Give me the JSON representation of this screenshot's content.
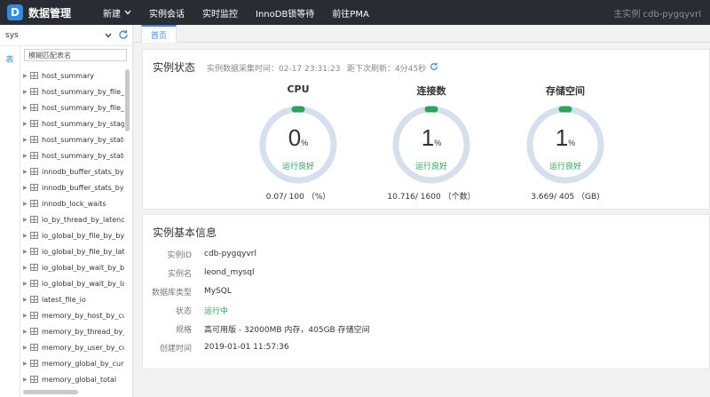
{
  "app": {
    "logo": "D",
    "title": "数据管理"
  },
  "nav": [
    {
      "label": "新建",
      "has_dropdown": true
    },
    {
      "label": "实例会话"
    },
    {
      "label": "实时监控"
    },
    {
      "label": "InnoDB锁等待"
    },
    {
      "label": "前往PMA"
    }
  ],
  "instance_label": "主实例 cdb-pygqyvrl",
  "sidebar": {
    "db_selected": "sys",
    "side_tab": "表",
    "filter_placeholder": "模糊匹配表名",
    "tables": [
      "host_summary",
      "host_summary_by_file_io",
      "host_summary_by_file_io_type",
      "host_summary_by_stages",
      "host_summary_by_statement_latency",
      "host_summary_by_statement_type",
      "innodb_buffer_stats_by_schema",
      "innodb_buffer_stats_by_table",
      "innodb_lock_waits",
      "io_by_thread_by_latency",
      "io_global_by_file_by_bytes",
      "io_global_by_file_by_latency",
      "io_global_by_wait_by_bytes",
      "io_global_by_wait_by_latency",
      "latest_file_io",
      "memory_by_host_by_current_bytes",
      "memory_by_thread_by_current_bytes",
      "memory_by_user_by_current_bytes",
      "memory_global_by_current_bytes",
      "memory_global_total"
    ]
  },
  "tabs": [
    {
      "label": "首页",
      "active": true
    }
  ],
  "status_card": {
    "title": "实例状态",
    "collected_at": "实例数据采集时间：02-17 23:31:23",
    "next_refresh": "距下次刷新：4分45秒",
    "gauges": [
      {
        "title": "CPU",
        "value": "0",
        "unit": "%",
        "status": "运行良好",
        "caption": "0.07/ 100 （%）",
        "fraction": 0.0007
      },
      {
        "title": "连接数",
        "value": "1",
        "unit": "%",
        "status": "运行良好",
        "caption": "10.716/ 1600 （个数）",
        "fraction": 0.0067
      },
      {
        "title": "存储空间",
        "value": "1",
        "unit": "%",
        "status": "运行良好",
        "caption": "3.669/ 405 （GB)",
        "fraction": 0.0091
      }
    ]
  },
  "info_card": {
    "title": "实例基本信息",
    "rows": [
      {
        "key": "实例ID",
        "value": "cdb-pygqyvrl"
      },
      {
        "key": "实例名",
        "value": "leond_mysql"
      },
      {
        "key": "数据库类型",
        "value": "MySQL"
      },
      {
        "key": "状态",
        "value": "运行中",
        "ok": true
      },
      {
        "key": "规格",
        "value": "高可用版 - 32000MB 内存，405GB 存储空间"
      },
      {
        "key": "创建时间",
        "value": "2019-01-01 11:57:36"
      }
    ]
  },
  "colors": {
    "accent": "#2d8cf0",
    "ok": "#26a65b",
    "gauge_track": "#d6dfed",
    "topbar": "#2a2c33"
  }
}
